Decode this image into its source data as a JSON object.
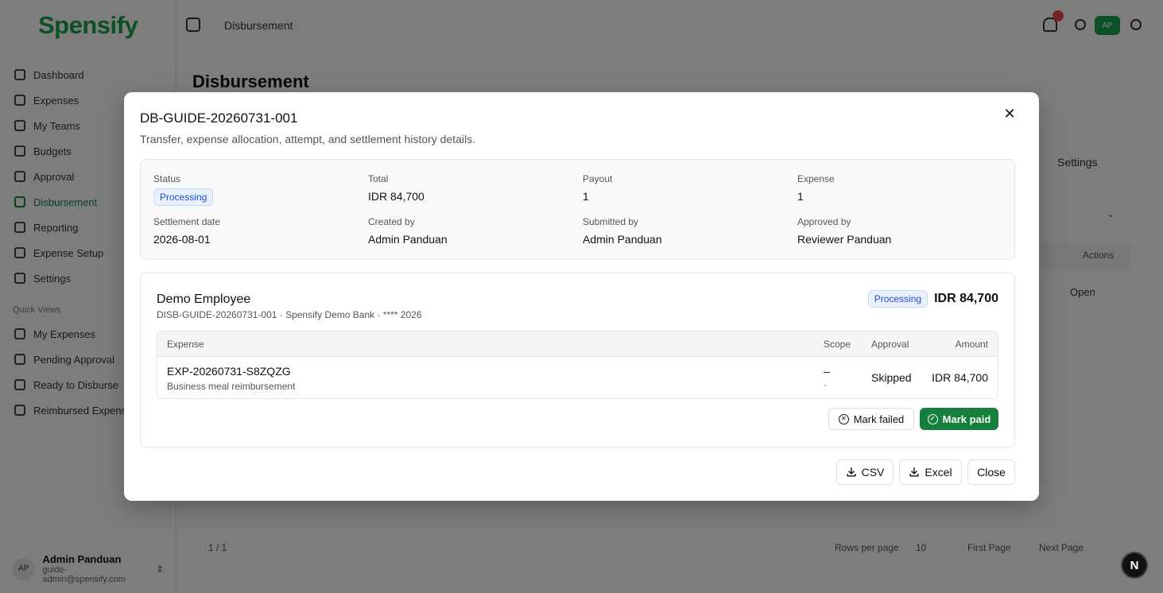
{
  "app": {
    "logo": "Spensify",
    "breadcrumb": "Disbursement",
    "page_title": "Disbursement",
    "nav_items": [
      "Dashboard",
      "Expenses",
      "My Teams",
      "Budgets",
      "Approval",
      "Disbursement",
      "Reporting",
      "Expense Setup",
      "Settings"
    ],
    "quick_views_label": "Quick Views",
    "quick_views": [
      "My Expenses",
      "Pending Approval",
      "Ready to Disburse",
      "Reimbursed Expenses"
    ],
    "user": {
      "initials": "AP",
      "name": "Admin Panduan",
      "email": "guide-admin@spensify.com"
    },
    "top_avatar": "AP",
    "settings_label": "Settings",
    "actions_header": "Actions",
    "open_label": "Open",
    "footer": {
      "count": "1 / 1",
      "rows_label": "Rows per page",
      "rows_value": "10",
      "first": "First Page",
      "next": "Next Page"
    },
    "next_badge": "N",
    "brand_color": "#16a34a"
  },
  "dialog": {
    "title": "DB-GUIDE-20260731-001",
    "description": "Transfer, expense allocation, attempt, and settlement history details.",
    "summary": {
      "status_label": "Status",
      "status_value": "Processing",
      "total_label": "Total",
      "total_value": "IDR 84,700",
      "payout_label": "Payout",
      "payout_value": "1",
      "expense_label": "Expense",
      "expense_value": "1",
      "settlement_label": "Settlement date",
      "settlement_value": "2026-08-01",
      "created_label": "Created by",
      "created_value": "Admin Panduan",
      "submitted_label": "Submitted by",
      "submitted_value": "Admin Panduan",
      "approved_label": "Approved by",
      "approved_value": "Reviewer Panduan"
    },
    "payout": {
      "employee": "Demo Employee",
      "meta": "DISB-GUIDE-20260731-001 · Spensify Demo Bank · **** 2026",
      "status": "Processing",
      "amount": "IDR 84,700",
      "table": {
        "headers": {
          "expense": "Expense",
          "scope": "Scope",
          "approval": "Approval",
          "amount": "Amount"
        },
        "rows": [
          {
            "id": "EXP-20260731-S8ZQZG",
            "description": "Business meal reimbursement",
            "scope_main": "–",
            "scope_sub": "-",
            "approval": "Skipped",
            "amount": "IDR 84,700"
          }
        ]
      },
      "mark_failed": "Mark failed",
      "mark_paid": "Mark paid"
    },
    "buttons": {
      "csv": "CSV",
      "excel": "Excel",
      "close": "Close"
    }
  }
}
